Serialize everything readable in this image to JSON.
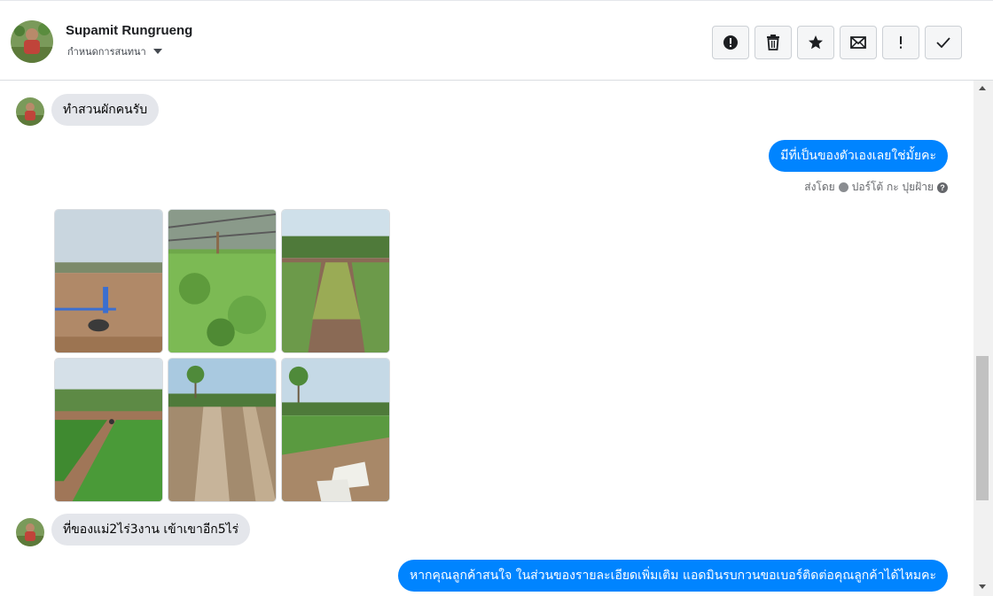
{
  "header": {
    "contact_name": "Supamit Rungrueng",
    "assign_label": "กำหนดการสนทนา",
    "actions": [
      {
        "icon": "alert-circle-icon",
        "name": "mark-spam-button"
      },
      {
        "icon": "trash-icon",
        "name": "delete-button"
      },
      {
        "icon": "star-icon",
        "name": "star-button"
      },
      {
        "icon": "envelope-icon",
        "name": "mark-unread-button"
      },
      {
        "icon": "exclamation-icon",
        "name": "follow-up-button"
      },
      {
        "icon": "checkmark-icon",
        "name": "mark-done-button"
      }
    ]
  },
  "messages": {
    "m1": "ทำสวนผักคนรับ",
    "m2": "มีที่เป็นของตัวเองเลยใช่มั้ยคะ",
    "sent_by_prefix": "ส่งโดย",
    "sent_by_name": "ปอร์โต้ กะ ปุยฝ้าย",
    "m3": "ที่ของแม่2ไร่3งาน เข้าเขาอีก5ไร่",
    "m4": "หากคุณลูกค้าสนใจ ในส่วนของรายละเอียดเพิ่มเติม แอดมินรบกวนขอเบอร์ติดต่อคุณลูกค้าได้ไหมคะ"
  },
  "photos": [
    {
      "name": "photo-dry-field"
    },
    {
      "name": "photo-greenhouse-vegetables"
    },
    {
      "name": "photo-dill-rows"
    },
    {
      "name": "photo-vegetable-rows-workers"
    },
    {
      "name": "photo-plowed-field-palms"
    },
    {
      "name": "photo-field-with-sacks"
    }
  ],
  "colors": {
    "outgoing_bubble": "#0084ff",
    "incoming_bubble": "#e4e6eb"
  }
}
